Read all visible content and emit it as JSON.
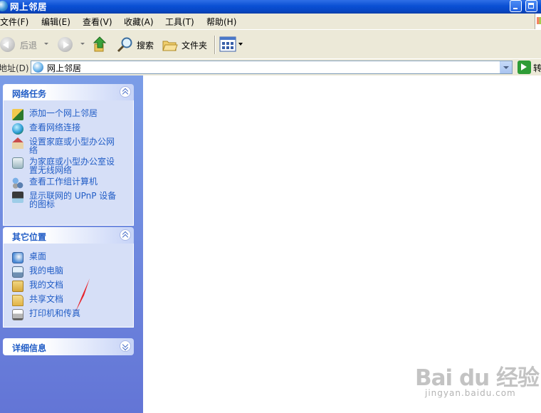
{
  "window": {
    "title": "网上邻居"
  },
  "menubar": [
    "文件(F)",
    "编辑(E)",
    "查看(V)",
    "收藏(A)",
    "工具(T)",
    "帮助(H)"
  ],
  "toolbar": {
    "back_label": "后退",
    "search_label": "搜索",
    "folders_label": "文件夹"
  },
  "addressbar": {
    "label": "地址(D)",
    "value": "网上邻居",
    "go_label": "转"
  },
  "tasks": {
    "network_tasks": {
      "title": "网络任务",
      "items": [
        {
          "icon": "add-network-place-icon",
          "lines": [
            "添加一个网上邻居"
          ]
        },
        {
          "icon": "network-connections-icon",
          "lines": [
            "查看网络连接"
          ]
        },
        {
          "icon": "home-network-icon",
          "lines": [
            "设置家庭或小型办公网",
            "络"
          ]
        },
        {
          "icon": "wireless-network-icon",
          "lines": [
            "为家庭或小型办公室设",
            "置无线网络"
          ]
        },
        {
          "icon": "workgroup-icon",
          "lines": [
            "查看工作组计算机"
          ]
        },
        {
          "icon": "upnp-devices-icon",
          "lines": [
            "显示联网的 UPnP 设备",
            "的图标"
          ]
        }
      ]
    },
    "other_places": {
      "title": "其它位置",
      "items": [
        {
          "icon": "desktop-icon",
          "label": "桌面"
        },
        {
          "icon": "my-computer-icon",
          "label": "我的电脑"
        },
        {
          "icon": "my-documents-icon",
          "label": "我的文档"
        },
        {
          "icon": "shared-documents-icon",
          "label": "共享文档"
        },
        {
          "icon": "printer-icon",
          "label": "打印机和传真"
        }
      ]
    },
    "details": {
      "title": "详细信息"
    }
  },
  "watermark": {
    "brand": "Bai du 经验",
    "url": "jingyan.baidu.com"
  },
  "colors": {
    "title_bar": "#0a4fd4",
    "task_pane": "#6f8ce0",
    "link": "#215dc6",
    "annotation_arrow": "#e8222a"
  }
}
